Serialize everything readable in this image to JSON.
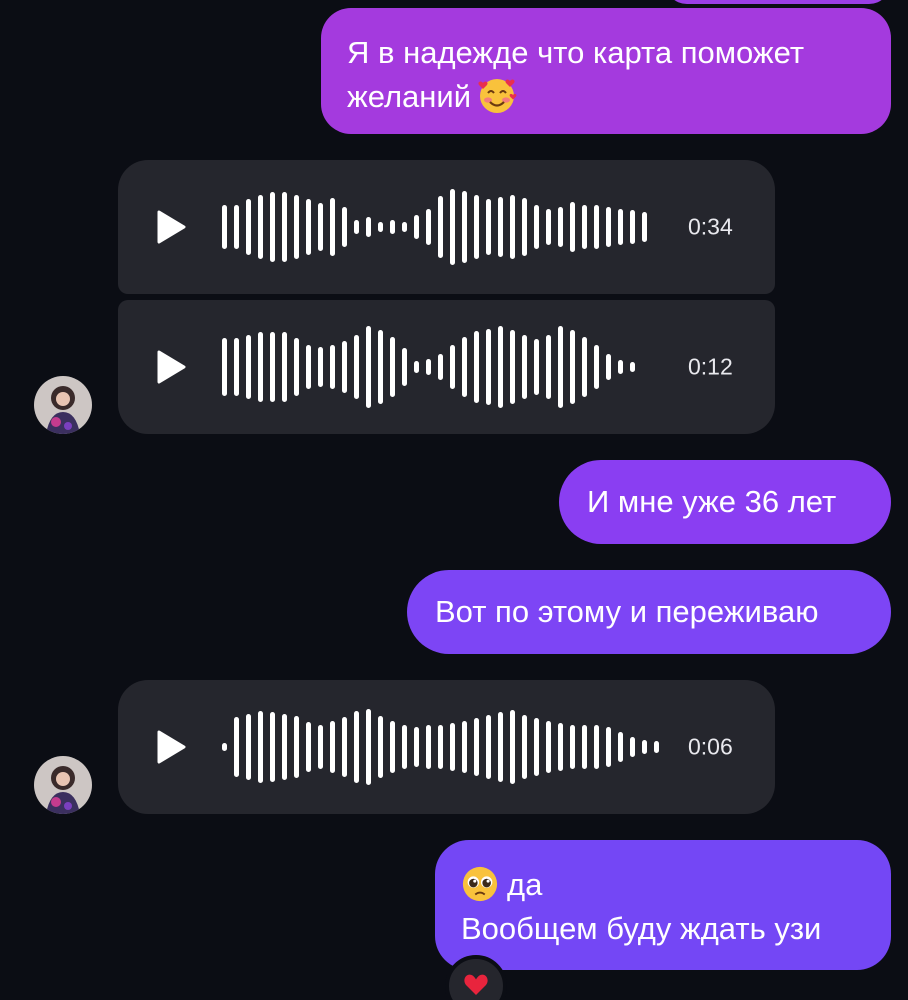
{
  "messages": {
    "top_partial": "",
    "m1": {
      "line1": "Я в надежде что карта поможет",
      "line2": "желаний",
      "emoji": "smiling-face-with-hearts-icon"
    },
    "voice1": {
      "duration": "0:34"
    },
    "voice2": {
      "duration": "0:12"
    },
    "m2": {
      "text": "И мне уже 36 лет"
    },
    "m3": {
      "text": "Вот по этому и переживаю"
    },
    "voice3": {
      "duration": "0:06"
    },
    "m4": {
      "line1": "да",
      "line2": "Вообщем буду ждать узи",
      "emoji": "pleading-face-icon",
      "reaction": "red-heart-icon"
    }
  },
  "colors": {
    "background": "#0b0d14",
    "incoming_bubble": "#25262d",
    "outgoing_gradient": [
      "#a43ade",
      "#8a3ef2",
      "#7d45f5",
      "#7447f5"
    ],
    "text": "#ffffff"
  }
}
